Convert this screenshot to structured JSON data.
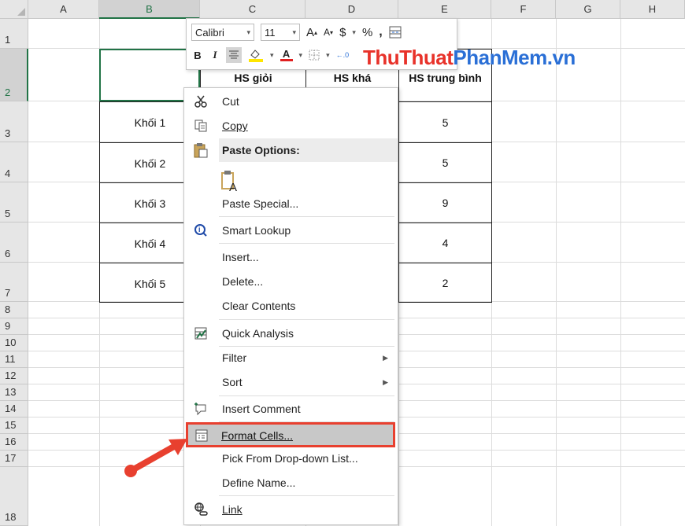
{
  "columns": [
    "A",
    "B",
    "C",
    "D",
    "E",
    "F",
    "G",
    "H"
  ],
  "rows": [
    "1",
    "2",
    "3",
    "4",
    "5",
    "6",
    "7",
    "8",
    "9",
    "10",
    "11",
    "12",
    "13",
    "14",
    "15",
    "16",
    "17",
    "18"
  ],
  "table": {
    "headers": [
      "HS giỏi",
      "HS khá",
      "HS trung bình"
    ],
    "rows": [
      {
        "label": "Khối 1",
        "last": "5"
      },
      {
        "label": "Khối 2",
        "last": "5"
      },
      {
        "label": "Khối 3",
        "last": "9"
      },
      {
        "label": "Khối 4",
        "last": "4"
      },
      {
        "label": "Khối 5",
        "last": "2"
      }
    ]
  },
  "mini_toolbar": {
    "font": "Calibri",
    "size": "11",
    "grow": "A",
    "shrink": "A",
    "currency": "$",
    "percent": "%",
    "comma": ",",
    "bold": "B",
    "italic": "I",
    "font_color_letter": "A"
  },
  "watermark": {
    "part1": "ThuThuat",
    "part2": "PhanMem.vn"
  },
  "menu": {
    "cut": "Cut",
    "copy": "Copy",
    "paste_options": "Paste Options:",
    "paste_special": "Paste Special...",
    "smart_lookup": "Smart Lookup",
    "insert": "Insert...",
    "delete": "Delete...",
    "clear_contents": "Clear Contents",
    "quick_analysis": "Quick Analysis",
    "filter": "Filter",
    "sort": "Sort",
    "insert_comment": "Insert Comment",
    "format_cells": "Format Cells...",
    "pick_list": "Pick From Drop-down List...",
    "define_name": "Define Name...",
    "link": "Link"
  },
  "colors": {
    "accent_green": "#217346",
    "highlight_red": "#e8402f",
    "font_color_red": "#e02020",
    "fill_yellow": "#ffe600"
  }
}
